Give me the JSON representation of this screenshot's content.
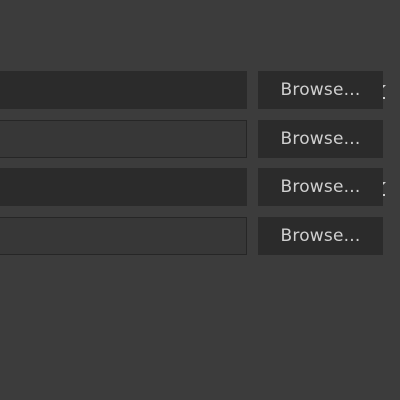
{
  "rows": [
    {
      "has_swap_icon": true,
      "field_value": "",
      "browse_label": "Browse..."
    },
    {
      "has_swap_icon": false,
      "field_value": "",
      "browse_label": "Browse..."
    },
    {
      "has_swap_icon": true,
      "field_value": "",
      "browse_label": "Browse..."
    },
    {
      "has_swap_icon": false,
      "field_value": "",
      "browse_label": "Browse..."
    }
  ],
  "icons": {
    "swap": "swap-arrows-icon"
  },
  "colors": {
    "background": "#3c3c3c",
    "field_dark": "#2b2b2b",
    "field_empty": "#373737",
    "button": "#2b2b2b",
    "button_text": "#cfcfcf",
    "icon": "#cfcfcf"
  }
}
